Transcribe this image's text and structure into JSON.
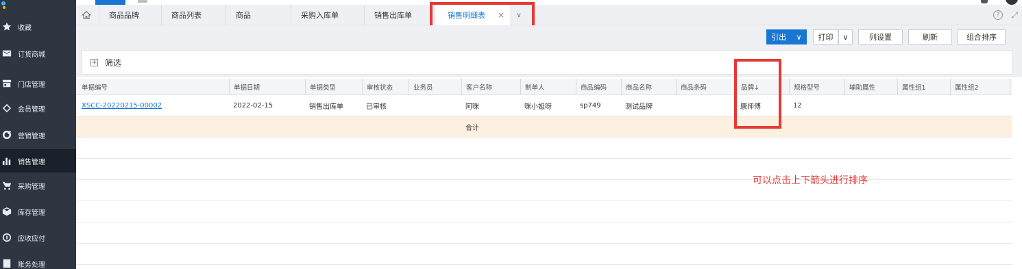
{
  "sidebar": {
    "items": [
      {
        "label": "收藏",
        "icon": "star-icon"
      },
      {
        "label": "订货商城",
        "icon": "mail-icon"
      },
      {
        "label": "门店管理",
        "icon": "store-icon"
      },
      {
        "label": "会员管理",
        "icon": "diamond-icon"
      },
      {
        "label": "营销管理",
        "icon": "marketing-icon"
      },
      {
        "label": "销售管理",
        "icon": "bar-chart-icon"
      },
      {
        "label": "采购管理",
        "icon": "cart-icon"
      },
      {
        "label": "库存管理",
        "icon": "box-icon"
      },
      {
        "label": "应收应付",
        "icon": "coin-icon"
      },
      {
        "label": "账务处理",
        "icon": "ledger-icon"
      }
    ]
  },
  "tabs": {
    "items": [
      "商品品牌",
      "商品列表",
      "商品",
      "采购入库单",
      "销售出库单",
      "销售明细表"
    ],
    "active_close": "×",
    "help": "?"
  },
  "toolbar": {
    "export_label": "引出",
    "print_label": "打印",
    "columns_label": "列设置",
    "refresh_label": "刷新",
    "sort_label": "组合排序",
    "caret": "∨"
  },
  "filter": {
    "plus": "+",
    "label": "筛选"
  },
  "table": {
    "headers": [
      "单据编号",
      "单据日期",
      "单据类型",
      "审核状态",
      "业务员",
      "客户名称",
      "制单人",
      "商品编码",
      "商品名称",
      "商品条码",
      "品牌↓",
      "规格型号",
      "辅助属性",
      "属性组1",
      "属性组2"
    ],
    "rows": [
      {
        "doc_no": "XSCC-20220215-00002",
        "date": "2022-02-15",
        "doc_type": "销售出库单",
        "audit": "已审核",
        "salesman": "",
        "customer": "阿咪",
        "creator": "咪小姐呀",
        "product_code": "sp749",
        "product_name": "测试品牌",
        "barcode": "",
        "brand": "康师傅",
        "spec": "12"
      }
    ],
    "total_label": "合计"
  },
  "annotation": {
    "text": "可以点击上下箭头进行排序"
  },
  "colors": {
    "accent": "#1976d2",
    "sidebar": "#2f3541",
    "annotation_red": "#e53935",
    "total_row": "#fdf0e0"
  }
}
